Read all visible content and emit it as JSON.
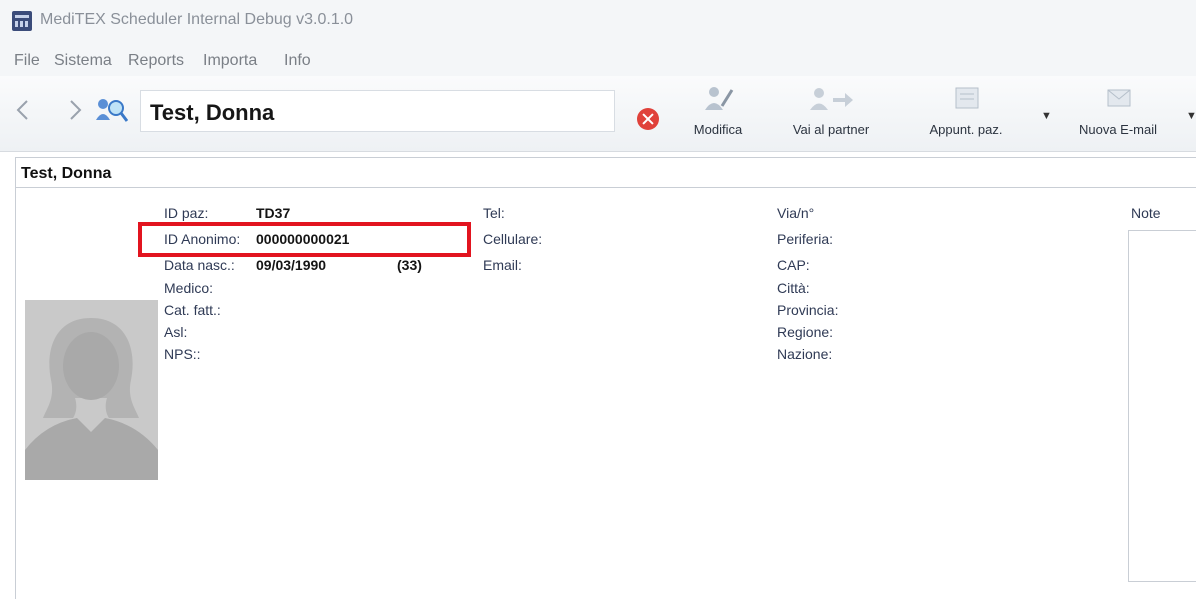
{
  "window": {
    "title": "MediTEX Scheduler Internal Debug v3.0.1.0"
  },
  "menu": [
    "File",
    "Sistema",
    "Reports",
    "Importa",
    "Info"
  ],
  "toolbar": {
    "patient_name": "Test, Donna",
    "buttons": [
      {
        "label": "Modifica"
      },
      {
        "label": "Vai al partner"
      },
      {
        "label": "Appunt. paz."
      },
      {
        "label": "Nuova E-mail"
      }
    ]
  },
  "panel": {
    "title": "Test, Donna",
    "col1": {
      "id_paz_label": "ID paz:",
      "id_paz_value": "TD37",
      "id_anonimo_label": "ID Anonimo:",
      "id_anonimo_value": "000000000021",
      "data_nasc_label": "Data nasc.:",
      "data_nasc_value": "09/03/1990",
      "age_value": "(33)",
      "medico_label": "Medico:",
      "cat_fatt_label": "Cat. fatt.:",
      "asl_label": "Asl:",
      "nps_label": "NPS::"
    },
    "col2": {
      "tel_label": "Tel:",
      "cellulare_label": "Cellulare:",
      "email_label": "Email:"
    },
    "col3": {
      "via_label": "Via/n°",
      "periferia_label": "Periferia:",
      "cap_label": "CAP:",
      "citta_label": "Città:",
      "provincia_label": "Provincia:",
      "regione_label": "Regione:",
      "nazione_label": "Nazione:"
    },
    "note_label": "Note"
  },
  "colors": {
    "highlight": "#e2141f",
    "label_text": "#2f3a55",
    "clear_button": "#e0413a"
  }
}
